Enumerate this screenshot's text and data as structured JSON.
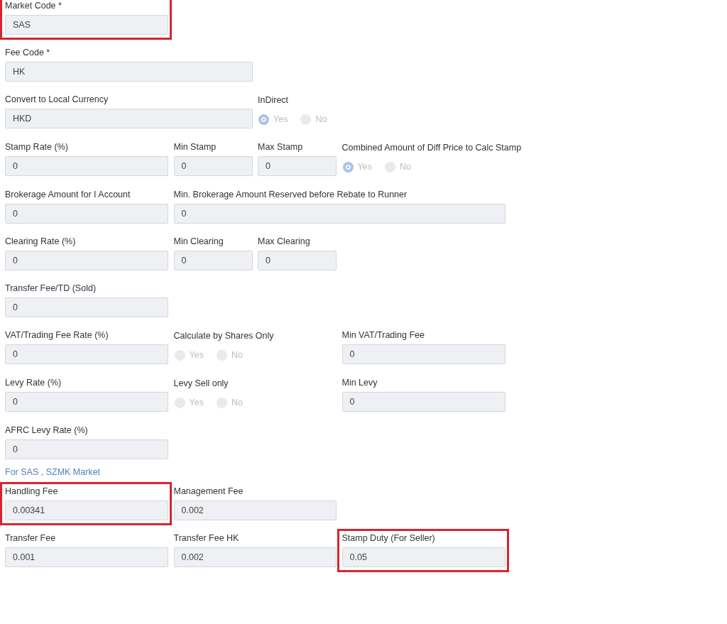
{
  "rows": [
    {
      "kind": "fields",
      "fields": [
        {
          "kind": "input",
          "label": "Market Code *",
          "value": "SAS",
          "highlighted": true
        }
      ]
    },
    {
      "kind": "fields",
      "fields": [
        {
          "kind": "input",
          "label": "Fee Code *",
          "value": "HK",
          "highlighted": false
        }
      ]
    },
    {
      "kind": "fields",
      "fields": [
        {
          "kind": "input",
          "label": "Convert to Local Currency",
          "value": "HKD",
          "highlighted": false
        },
        {
          "kind": "radio",
          "label": "InDirect",
          "options": [
            {
              "label": "Yes",
              "selected": true
            },
            {
              "label": "No",
              "selected": false
            }
          ]
        }
      ]
    },
    {
      "kind": "fields",
      "fields": [
        {
          "kind": "input",
          "label": "Stamp Rate (%)",
          "value": "0",
          "highlighted": false
        },
        {
          "kind": "input",
          "label": "Min Stamp",
          "value": "0",
          "highlighted": false
        },
        {
          "kind": "input",
          "label": "Max Stamp",
          "value": "0",
          "highlighted": false
        },
        {
          "kind": "radio",
          "label": "Combined Amount of Diff Price to Calc Stamp",
          "options": [
            {
              "label": "Yes",
              "selected": true
            },
            {
              "label": "No",
              "selected": false
            }
          ]
        }
      ]
    },
    {
      "kind": "fields",
      "fields": [
        {
          "kind": "input",
          "label": "Brokerage Amount for I Account",
          "value": "0",
          "highlighted": false
        },
        {
          "kind": "input",
          "label": "Min. Brokerage Amount Reserved before Rebate to Runner",
          "value": "0",
          "highlighted": false
        }
      ]
    },
    {
      "kind": "fields",
      "fields": [
        {
          "kind": "input",
          "label": "Clearing Rate (%)",
          "value": "0",
          "highlighted": false
        },
        {
          "kind": "input",
          "label": "Min Clearing",
          "value": "0",
          "highlighted": false
        },
        {
          "kind": "input",
          "label": "Max Clearing",
          "value": "0",
          "highlighted": false
        }
      ]
    },
    {
      "kind": "fields",
      "fields": [
        {
          "kind": "input",
          "label": "Transfer Fee/TD (Sold)",
          "value": "0",
          "highlighted": false
        }
      ]
    },
    {
      "kind": "fields",
      "fields": [
        {
          "kind": "input",
          "label": "VAT/Trading Fee Rate (%)",
          "value": "0",
          "highlighted": false
        },
        {
          "kind": "radio",
          "label": "Calculate by Shares Only",
          "options": [
            {
              "label": "Yes",
              "selected": false
            },
            {
              "label": "No",
              "selected": false
            }
          ]
        },
        {
          "kind": "input",
          "label": "Min VAT/Trading Fee",
          "value": "0",
          "highlighted": false
        }
      ]
    },
    {
      "kind": "fields",
      "fields": [
        {
          "kind": "input",
          "label": "Levy Rate (%)",
          "value": "0",
          "highlighted": false
        },
        {
          "kind": "radio",
          "label": "Levy Sell only",
          "options": [
            {
              "label": "Yes",
              "selected": false
            },
            {
              "label": "No",
              "selected": false
            }
          ]
        },
        {
          "kind": "input",
          "label": "Min Levy",
          "value": "0",
          "highlighted": false
        }
      ]
    },
    {
      "kind": "fields",
      "fields": [
        {
          "kind": "input",
          "label": "AFRC Levy Rate (%)",
          "value": "0",
          "highlighted": false
        }
      ]
    },
    {
      "kind": "section",
      "text": "For SAS , SZMK Market"
    },
    {
      "kind": "fields",
      "fields": [
        {
          "kind": "input",
          "label": "Handling Fee",
          "value": "0.00341",
          "highlighted": true
        },
        {
          "kind": "input",
          "label": "Management Fee",
          "value": "0.002",
          "highlighted": false
        }
      ]
    },
    {
      "kind": "fields",
      "fields": [
        {
          "kind": "input",
          "label": "Transfer Fee",
          "value": "0.001",
          "highlighted": false
        },
        {
          "kind": "input",
          "label": "Transfer Fee HK",
          "value": "0.002",
          "highlighted": false
        },
        {
          "kind": "input",
          "label": "Stamp Duty (For Seller)",
          "value": "0.05",
          "highlighted": true
        }
      ]
    }
  ]
}
